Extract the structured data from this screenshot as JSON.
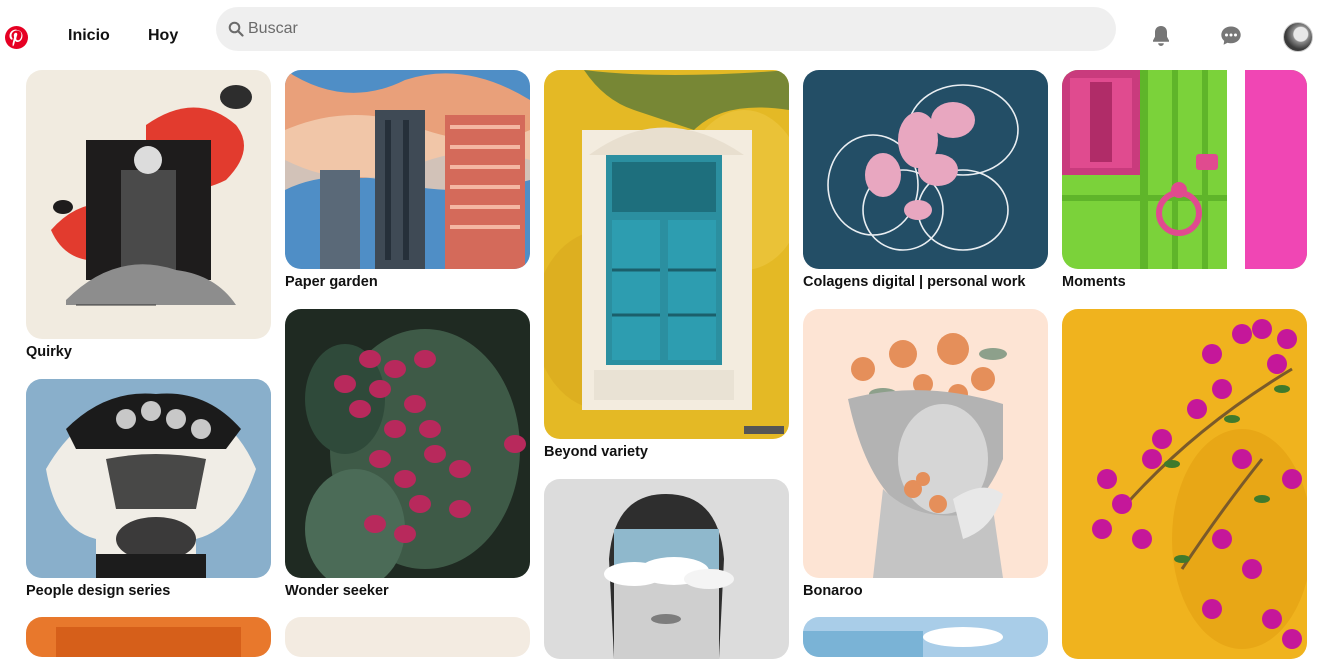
{
  "header": {
    "nav": [
      "Inicio",
      "Hoy"
    ],
    "search_placeholder": "Buscar",
    "icons": [
      "pinterest-logo-icon",
      "search-icon",
      "bell-icon",
      "chat-icon",
      "avatar"
    ]
  },
  "pins": [
    {
      "title": "Quirky"
    },
    {
      "title": "Paper garden"
    },
    {
      "title": "Beyond variety"
    },
    {
      "title": "Colagens digital | personal work"
    },
    {
      "title": "Moments"
    },
    {
      "title": "People design series"
    },
    {
      "title": "Wonder seeker"
    },
    {
      "title": "Bonaroo"
    }
  ],
  "colors": {
    "brand": "#e60023",
    "search_bg": "#efefef"
  }
}
